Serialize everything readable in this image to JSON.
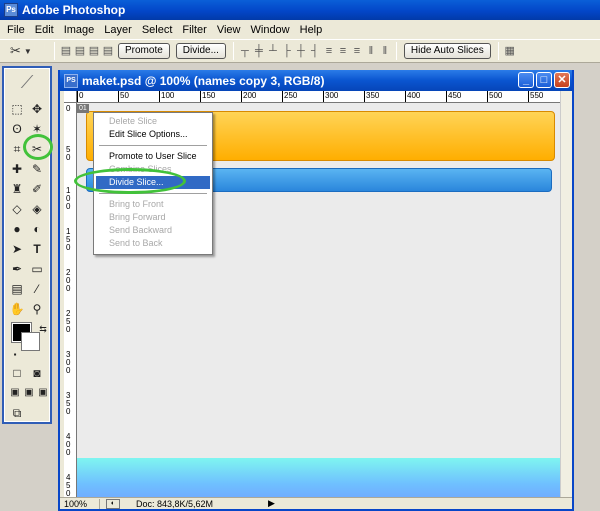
{
  "app": {
    "title": "Adobe Photoshop",
    "icon": "photoshop-icon"
  },
  "menu": [
    "File",
    "Edit",
    "Image",
    "Layer",
    "Select",
    "Filter",
    "View",
    "Window",
    "Help"
  ],
  "options": {
    "tool_icon": "slice-select-icon",
    "promote_label": "Promote",
    "divide_label": "Divide...",
    "hide_auto_slices_label": "Hide Auto Slices"
  },
  "document": {
    "title": "maket.psd @ 100% (names copy 3, RGB/8)",
    "slice_tag": "01",
    "zoom": "100%",
    "doc_size": "Doc: 843,8K/5,62M",
    "ruler_top": [
      "0",
      "50",
      "100",
      "150",
      "200",
      "250",
      "300",
      "350",
      "400",
      "450",
      "500",
      "550"
    ],
    "ruler_left": [
      "0",
      "5 0",
      "1 0 0",
      "1 5 0",
      "2 0 0",
      "2 5 0",
      "3 0 0",
      "3 5 0",
      "4 0 0",
      "4 5 0"
    ],
    "colors": {
      "orange_bar": "#ffae00",
      "blue_bar": "#2a86dc",
      "footer_bar": "#7ff5f0"
    }
  },
  "context_menu": {
    "items": [
      {
        "label": "Delete Slice",
        "enabled": false
      },
      {
        "label": "Edit Slice Options...",
        "enabled": true
      },
      {
        "label": "Promote to User Slice",
        "enabled": true
      },
      {
        "label": "Combine Slices",
        "enabled": false
      },
      {
        "label": "Divide Slice...",
        "enabled": true,
        "highlighted": true
      },
      {
        "label": "Bring to Front",
        "enabled": false
      },
      {
        "label": "Bring Forward",
        "enabled": false
      },
      {
        "label": "Send Backward",
        "enabled": false
      },
      {
        "label": "Send to Back",
        "enabled": false
      }
    ]
  },
  "highlight_color": "#42c23a"
}
